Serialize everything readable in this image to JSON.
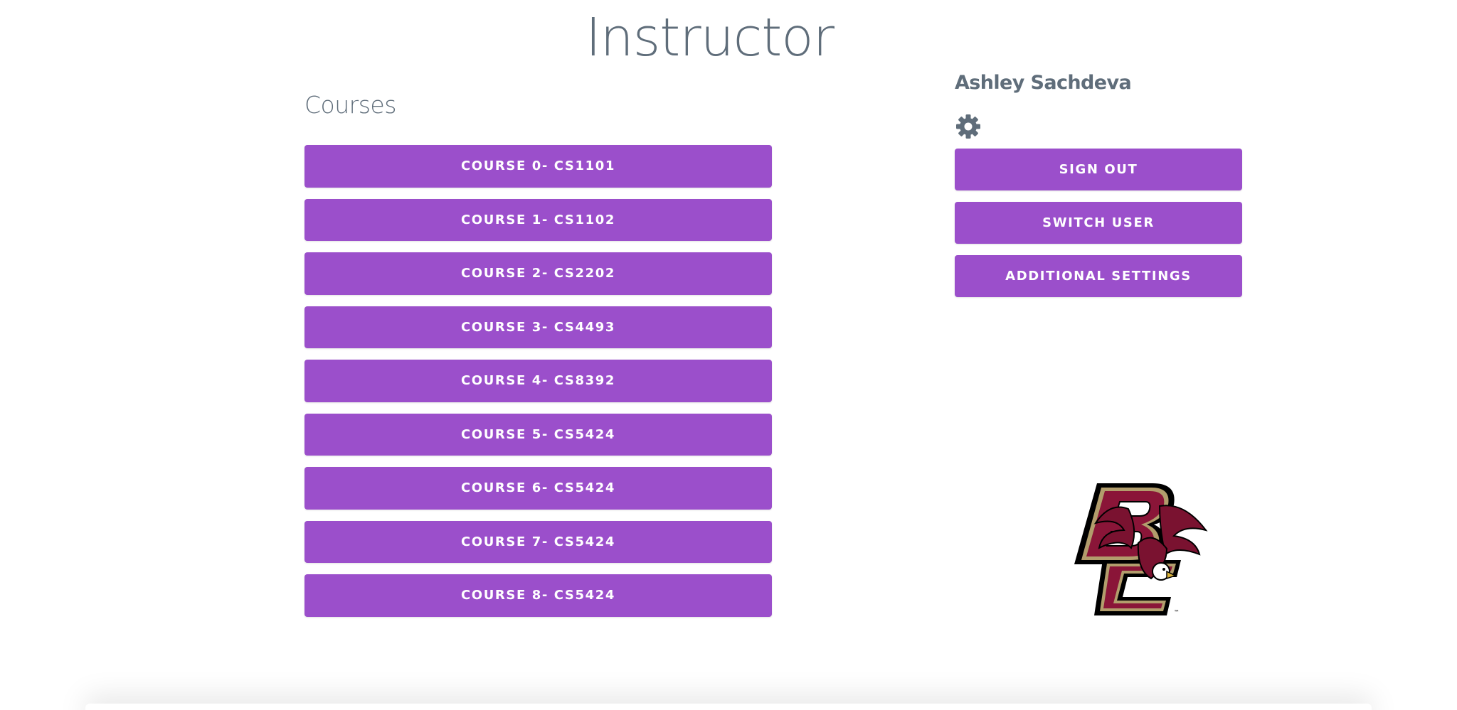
{
  "header": {
    "title": "Instructor"
  },
  "courses": {
    "heading": "Courses",
    "items": [
      {
        "label": "COURSE 0- CS1101"
      },
      {
        "label": "COURSE 1- CS1102"
      },
      {
        "label": "COURSE 2- CS2202"
      },
      {
        "label": "COURSE 3- CS4493"
      },
      {
        "label": "COURSE 4- CS8392"
      },
      {
        "label": "COURSE 5- CS5424"
      },
      {
        "label": "COURSE 6- CS5424"
      },
      {
        "label": "COURSE 7- CS5424"
      },
      {
        "label": "COURSE 8- CS5424"
      }
    ]
  },
  "user_panel": {
    "name": "Ashley Sachdeva",
    "settings_icon": "gear-icon",
    "sign_out_label": "SIGN OUT",
    "switch_user_label": "SWITCH USER",
    "additional_settings_label": "ADDITIONAL SETTINGS"
  },
  "logo": {
    "icon": "bc-eagle-logo",
    "trademark": "™"
  },
  "colors": {
    "button": "#9b4fcb",
    "text": "#5f6d7a",
    "logo_maroon": "#8a1538",
    "logo_gold": "#b29d6c"
  }
}
